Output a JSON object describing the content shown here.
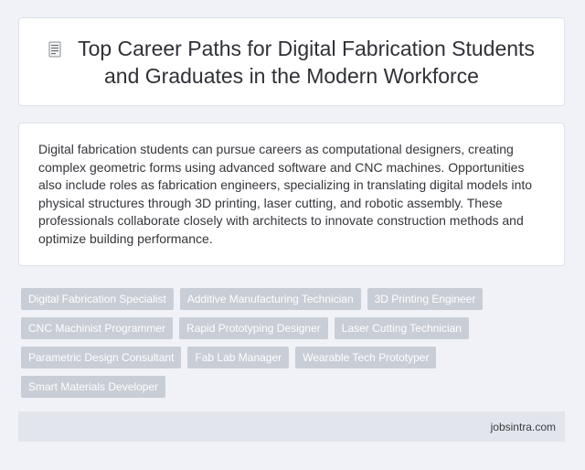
{
  "header": {
    "title": "Top Career Paths for Digital Fabrication Students and Graduates in the Modern Workforce",
    "icon": "document-icon"
  },
  "summary": {
    "text": "Digital fabrication students can pursue careers as computational designers, creating complex geometric forms using advanced software and CNC machines. Opportunities also include roles as fabrication engineers, specializing in translating digital models into physical structures through 3D printing, laser cutting, and robotic assembly. These professionals collaborate closely with architects to innovate construction methods and optimize building performance."
  },
  "tags": [
    "Digital Fabrication Specialist",
    "Additive Manufacturing Technician",
    "3D Printing Engineer",
    "CNC Machinist Programmer",
    "Rapid Prototyping Designer",
    "Laser Cutting Technician",
    "Parametric Design Consultant",
    "Fab Lab Manager",
    "Wearable Tech Prototyper",
    "Smart Materials Developer"
  ],
  "footer": {
    "site": "jobsintra.com"
  },
  "colors": {
    "background": "#f0f2f7",
    "tag_background": "#c9cdd6",
    "footer_background": "#e2e5ec"
  }
}
